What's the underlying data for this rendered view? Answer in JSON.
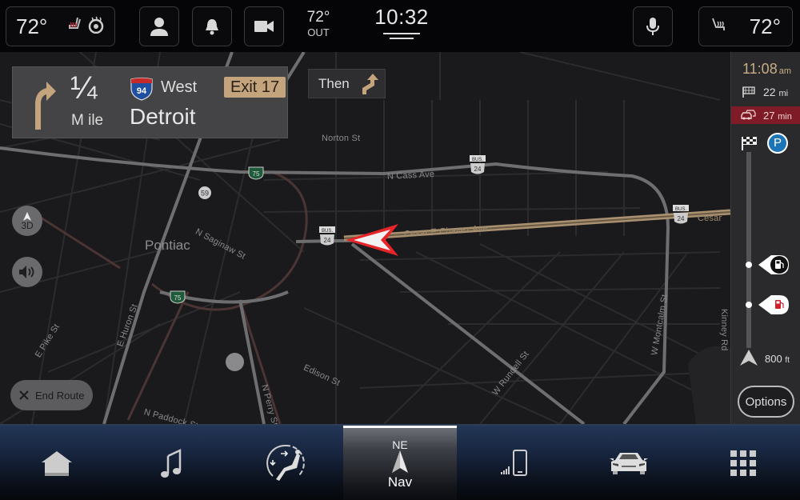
{
  "status_bar": {
    "driver_temp": "72°",
    "passenger_temp": "72°",
    "outside_temp": "72°",
    "outside_label": "OUT",
    "clock": "10:32"
  },
  "maneuver": {
    "distance": "¼",
    "distance_unit": "M ile",
    "highway_shield": "94",
    "direction": "West",
    "destination": "Detroit",
    "exit_label": "Exit 17",
    "then_label": "Then"
  },
  "map": {
    "city": "Pontiac",
    "streets": [
      {
        "name": "Norton St"
      },
      {
        "name": "N Cass Ave"
      },
      {
        "name": "N Saginaw St"
      },
      {
        "name": "Cesar E Chavez Ave"
      },
      {
        "name": "Cesar"
      },
      {
        "name": "E Pike St"
      },
      {
        "name": "E Huron St"
      },
      {
        "name": "Edison St"
      },
      {
        "name": "N Perry St"
      },
      {
        "name": "N Paddock St"
      },
      {
        "name": "W Rundell St"
      },
      {
        "name": "W Montcalm St"
      },
      {
        "name": "Kinney Rd"
      }
    ],
    "shields": {
      "i75": "75",
      "m59": "59",
      "bus_label": "BUS.",
      "us24": "24"
    },
    "controls": {
      "view_mode": "3D",
      "end_route": "End Route"
    }
  },
  "route_panel": {
    "eta": "11:08",
    "eta_suffix": "am",
    "distance": "22",
    "distance_unit": "mi",
    "traffic_time": "27",
    "traffic_unit": "min",
    "parking_label": "P",
    "next_distance": "800",
    "next_distance_unit": "ft",
    "options_label": "Options",
    "colors": {
      "traffic_bar": "#7e1b27",
      "eta": "#c8ad86",
      "parking": "#1e75b5"
    }
  },
  "bottom_nav": {
    "items": [
      {
        "id": "home"
      },
      {
        "id": "media"
      },
      {
        "id": "comfort"
      },
      {
        "id": "nav",
        "heading": "NE",
        "label": "Nav",
        "active": true
      },
      {
        "id": "phone"
      },
      {
        "id": "vehicle"
      },
      {
        "id": "apps"
      }
    ]
  }
}
